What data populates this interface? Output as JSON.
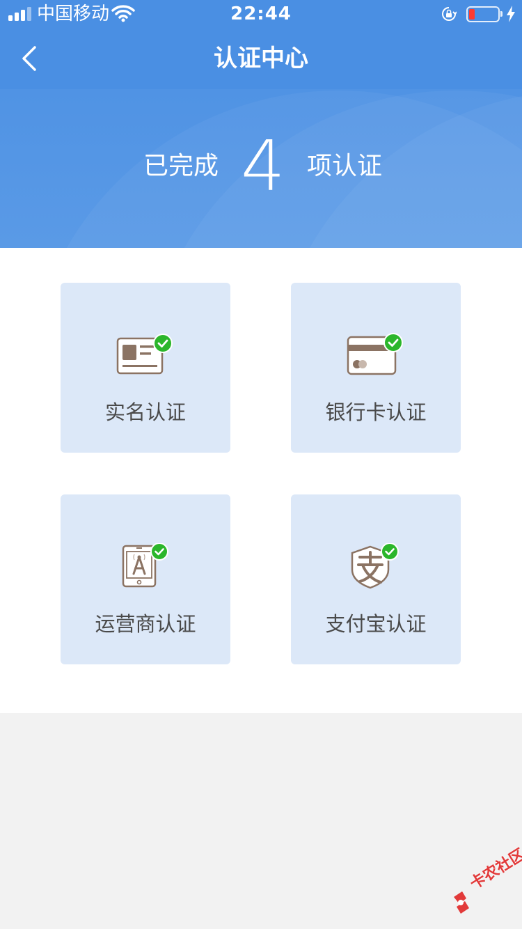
{
  "status_bar": {
    "carrier": "中国移动",
    "time": "22:44"
  },
  "nav": {
    "title": "认证中心"
  },
  "summary": {
    "prefix": "已完成",
    "count": "4",
    "suffix": "项认证"
  },
  "cards": [
    {
      "label": "实名认证",
      "icon": "id-card-icon",
      "status": "verified"
    },
    {
      "label": "银行卡认证",
      "icon": "bank-card-icon",
      "status": "verified"
    },
    {
      "label": "运营商认证",
      "icon": "phone-carrier-icon",
      "status": "verified"
    },
    {
      "label": "支付宝认证",
      "icon": "alipay-icon",
      "status": "verified"
    }
  ],
  "watermark": "卡农社区",
  "colors": {
    "header": "#4a8fe3",
    "card_bg": "#dce8f8",
    "icon_brown": "#8b7363",
    "check_green": "#2bb62b"
  }
}
